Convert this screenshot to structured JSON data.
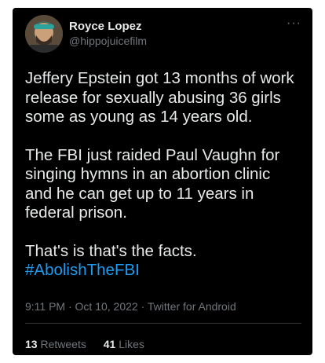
{
  "tweet": {
    "author": {
      "display_name": "Royce Lopez",
      "handle": "@hippojuicefilm"
    },
    "more_icon": "more-dots-icon",
    "paragraphs": {
      "p1": "Jeffery Epstein got 13 months of work release for sexually abusing 36 girls some as young as 14 years old.",
      "p2": "The FBI just raided Paul Vaughn for singing hymns in an abortion clinic and he can get up to 11 years in federal prison.",
      "p3": "That's is that's the facts.",
      "hashtag": "#AbolishTheFBI"
    },
    "timestamp": "9:11 PM · Oct 10, 2022 · ",
    "source": "Twitter for Android",
    "stats": {
      "retweets_count": "13",
      "retweets_label": "Retweets",
      "likes_count": "41",
      "likes_label": "Likes"
    }
  },
  "colors": {
    "background": "#000000",
    "text": "#e7e9ea",
    "secondary": "#71767b",
    "hashtag": "#1d9bf0"
  }
}
